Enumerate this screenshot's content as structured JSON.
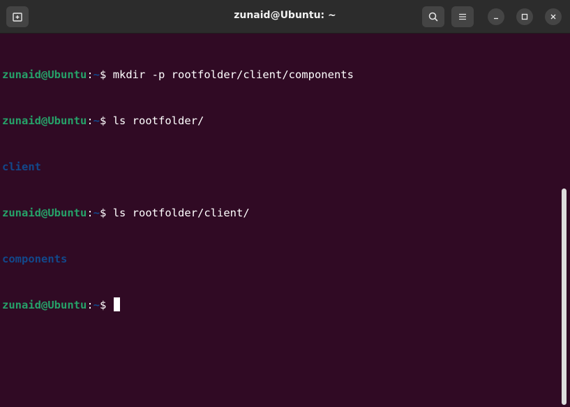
{
  "window": {
    "title": "zunaid@Ubuntu: ~"
  },
  "titlebar": {
    "new_tab_icon": "new-tab-icon",
    "search_icon": "search-icon",
    "menu_icon": "hamburger-menu-icon",
    "minimize_icon": "minimize-icon",
    "maximize_icon": "maximize-icon",
    "close_icon": "close-icon"
  },
  "colors": {
    "background": "#300a24",
    "prompt_user": "#26a269",
    "directory": "#12488b",
    "text": "#ffffff",
    "titlebar": "#2c2c2c"
  },
  "terminal": {
    "lines": [
      {
        "user": "zunaid@Ubuntu",
        "path": "~",
        "sep": ":",
        "prompt": "$ ",
        "command": "mkdir -p rootfolder/client/components"
      },
      {
        "user": "zunaid@Ubuntu",
        "path": "~",
        "sep": ":",
        "prompt": "$ ",
        "command": "ls rootfolder/"
      },
      {
        "output": "client"
      },
      {
        "user": "zunaid@Ubuntu",
        "path": "~",
        "sep": ":",
        "prompt": "$ ",
        "command": "ls rootfolder/client/"
      },
      {
        "output": "components"
      },
      {
        "user": "zunaid@Ubuntu",
        "path": "~",
        "sep": ":",
        "prompt": "$ ",
        "command": ""
      }
    ]
  }
}
